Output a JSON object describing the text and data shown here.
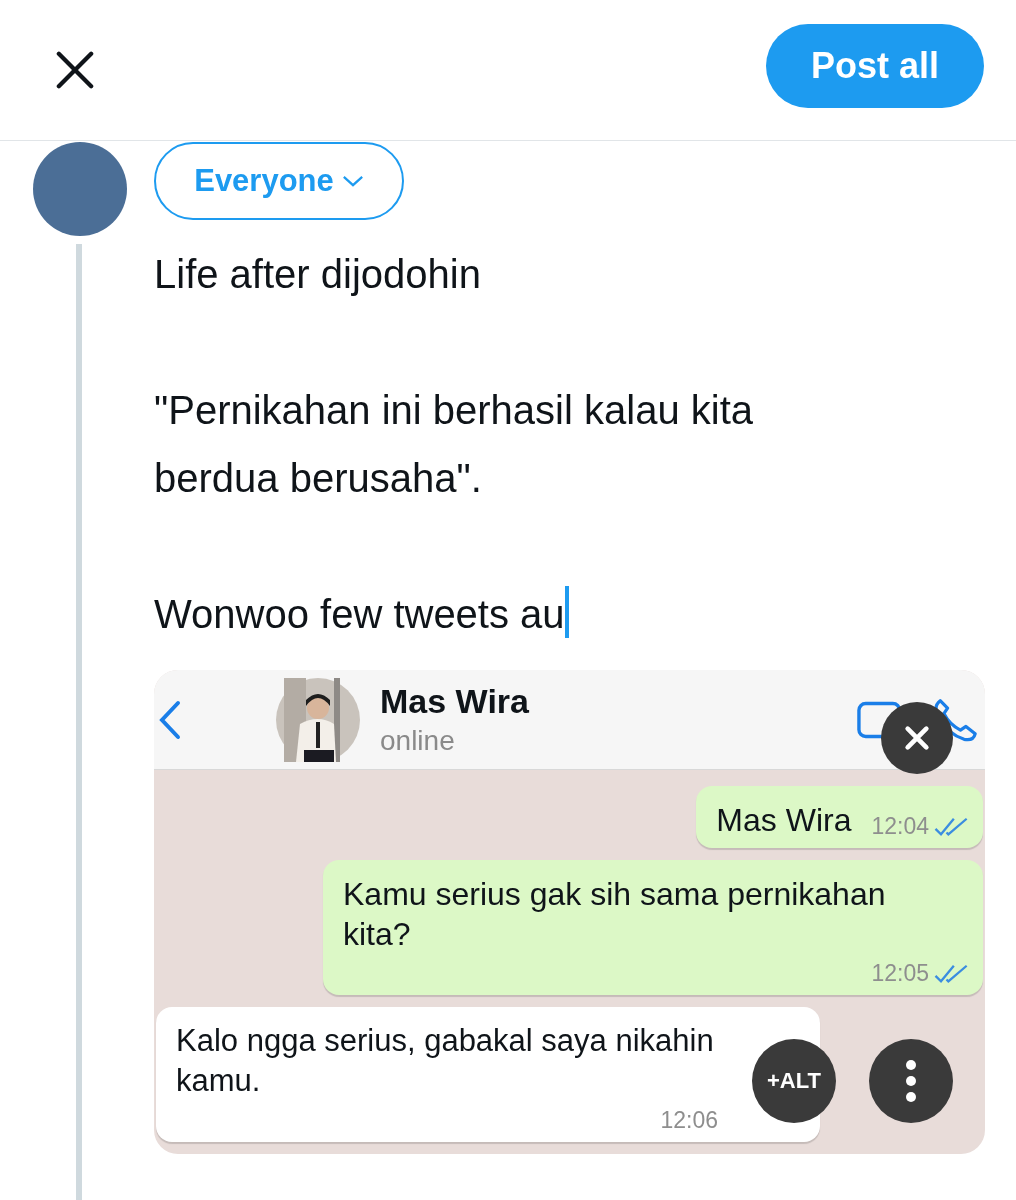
{
  "top_bar": {
    "post_button": "Post all"
  },
  "composer": {
    "audience": "Everyone",
    "text": "Life after dijodohin\n\n\"Pernikahan ini berhasil kalau kita berdua berusaha\".\n\nWonwoo few tweets au"
  },
  "attachment": {
    "contact_name": "Mas Wira",
    "contact_status": "online",
    "alt_button": "+ALT",
    "messages": [
      {
        "kind": "outgoing",
        "text": "Mas Wira",
        "time": "12:04",
        "read": true
      },
      {
        "kind": "outgoing",
        "text": "Kamu serius gak sih sama pernikahan kita?",
        "time": "12:05",
        "read": true
      },
      {
        "kind": "incoming",
        "text": "Kalo ngga serius, gabakal saya nikahin kamu.",
        "time": "12:06",
        "read": false
      }
    ]
  }
}
